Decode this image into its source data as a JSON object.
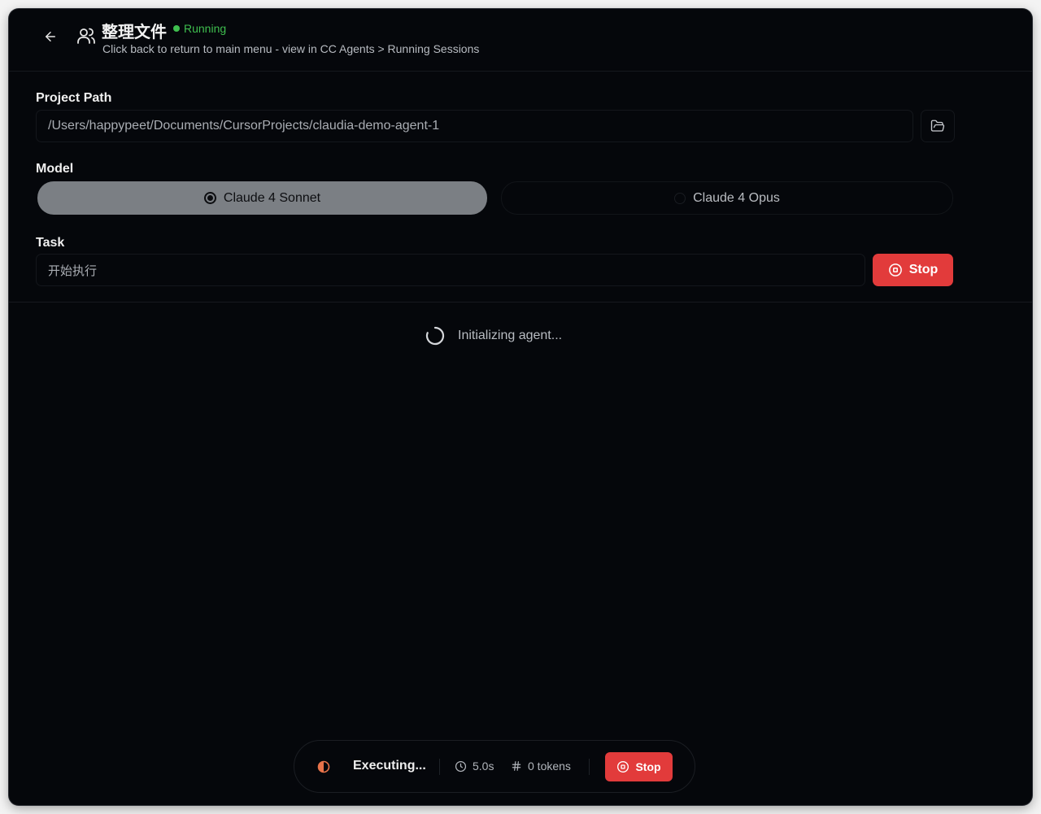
{
  "header": {
    "title": "整理文件",
    "status": "Running",
    "subtitle": "Click back to return to main menu - view in CC Agents > Running Sessions"
  },
  "project_path": {
    "label": "Project Path",
    "value": "/Users/happypeet/Documents/CursorProjects/claudia-demo-agent-1"
  },
  "model": {
    "label": "Model",
    "options": [
      {
        "label": "Claude 4 Sonnet",
        "selected": true
      },
      {
        "label": "Claude 4 Opus",
        "selected": false
      }
    ]
  },
  "task": {
    "label": "Task",
    "value": "开始执行",
    "stop_label": "Stop"
  },
  "output": {
    "loading_text": "Initializing agent..."
  },
  "execution_bar": {
    "status": "Executing...",
    "elapsed": "5.0s",
    "tokens": "0 tokens",
    "stop_label": "Stop"
  },
  "colors": {
    "background": "#05070b",
    "running_green": "#3fbf4f",
    "stop_red": "#e23b3b",
    "selected_model_bg": "#7b7f84",
    "executing_orange": "#e8734a"
  },
  "icons": [
    "arrow-left-icon",
    "users-icon",
    "folder-open-icon",
    "radio-selected-icon",
    "radio-unselected-icon",
    "stop-circle-icon",
    "loader-icon",
    "half-circle-icon",
    "clock-icon",
    "hash-icon"
  ]
}
